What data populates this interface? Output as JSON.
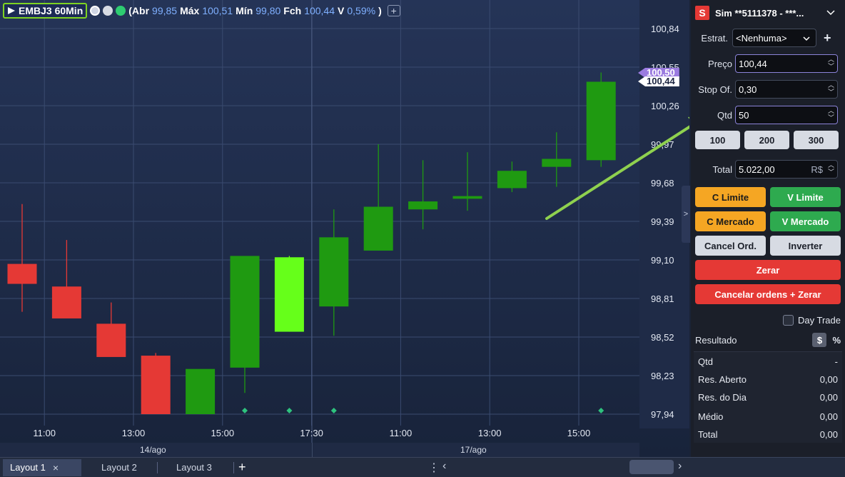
{
  "header": {
    "symbol": "EMBJ3 60Min",
    "ohlc_open_label": "(Abr",
    "ohlc_open": "99,85",
    "ohlc_high_label": "Máx",
    "ohlc_high": "100,51",
    "ohlc_low_label": "Mín",
    "ohlc_low": "99,80",
    "ohlc_close_label": "Fch",
    "ohlc_close": "100,44",
    "ohlc_var_label": "V",
    "ohlc_var": "0,59%",
    "ohlc_close_paren": ")",
    "add_study": "+"
  },
  "price_tags": {
    "last": "100,50",
    "close": "100,44"
  },
  "collapse_arrow": ">",
  "dates": [
    "14/ago",
    "17/ago"
  ],
  "colors": {
    "up": "#1f9a11",
    "up_bright": "#66ff1a",
    "down": "#e53935",
    "accent": "#7ed321"
  },
  "chart_data": {
    "type": "candlestick",
    "y_ticks": [
      "100,84",
      "100,55",
      "100,26",
      "99,97",
      "99,68",
      "99,39",
      "99,10",
      "98,81",
      "98,52",
      "98,23",
      "97,94"
    ],
    "x_ticks": [
      "11:00",
      "13:00",
      "15:00",
      "17:30",
      "11:00",
      "13:00",
      "15:00"
    ],
    "ylim": [
      97.94,
      100.84
    ],
    "candles": [
      {
        "o": 99.07,
        "h": 99.52,
        "l": 98.71,
        "c": 98.92,
        "color": "down"
      },
      {
        "o": 98.9,
        "h": 99.25,
        "l": 98.8,
        "c": 98.66,
        "color": "down"
      },
      {
        "o": 98.62,
        "h": 98.78,
        "l": 98.41,
        "c": 98.37,
        "color": "down"
      },
      {
        "o": 98.38,
        "h": 98.4,
        "l": 97.94,
        "c": 97.94,
        "color": "down"
      },
      {
        "o": 97.94,
        "h": 98.27,
        "l": 97.94,
        "c": 98.28,
        "color": "up"
      },
      {
        "o": 98.29,
        "h": 99.0,
        "l": 98.1,
        "c": 99.13,
        "color": "up"
      },
      {
        "o": 98.56,
        "h": 99.13,
        "l": 98.56,
        "c": 99.12,
        "color": "up_bright"
      },
      {
        "o": 98.75,
        "h": 99.48,
        "l": 98.53,
        "c": 99.27,
        "color": "up"
      },
      {
        "o": 99.17,
        "h": 99.97,
        "l": 99.17,
        "c": 99.5,
        "color": "up"
      },
      {
        "o": 99.48,
        "h": 99.85,
        "l": 99.33,
        "c": 99.54,
        "color": "up"
      },
      {
        "o": 99.56,
        "h": 99.91,
        "l": 99.47,
        "c": 99.58,
        "color": "up"
      },
      {
        "o": 99.64,
        "h": 99.84,
        "l": 99.61,
        "c": 99.77,
        "color": "up"
      },
      {
        "o": 99.8,
        "h": 100.06,
        "l": 99.65,
        "c": 99.86,
        "color": "up"
      },
      {
        "o": 99.85,
        "h": 100.51,
        "l": 99.8,
        "c": 100.44,
        "color": "up"
      }
    ],
    "markers_at_candles": [
      5,
      6,
      7,
      13
    ]
  },
  "panel": {
    "account_icon": "S",
    "account": "Sim **5111378 - ***...",
    "strategy_label": "Estrat.",
    "strategy_value": "<Nenhuma>",
    "price_label": "Preço",
    "price_value": "100,44",
    "stop_label": "Stop Of.",
    "stop_value": "0,30",
    "qty_label": "Qtd",
    "qty_value": "50",
    "qty_presets": [
      "100",
      "200",
      "300"
    ],
    "total_label": "Total",
    "total_value": "5.022,00",
    "total_currency": "R$",
    "buy_limit": "C Limite",
    "sell_limit": "V Limite",
    "buy_market": "C Mercado",
    "sell_market": "V Mercado",
    "cancel_orders": "Cancel Ord.",
    "invert": "Inverter",
    "flatten": "Zerar",
    "cancel_and_flatten": "Cancelar ordens + Zerar",
    "day_trade": "Day Trade",
    "result_label": "Resultado",
    "result_currency_toggle": "$",
    "result_percent_toggle": "%",
    "results": [
      {
        "label": "Qtd",
        "value": "-"
      },
      {
        "label": "Res. Aberto",
        "value": "0,00"
      },
      {
        "label": "Res. do Dia",
        "value": "0,00"
      },
      {
        "label": "Médio",
        "value": "0,00"
      },
      {
        "label": "Total",
        "value": "0,00"
      }
    ]
  },
  "tabs": [
    {
      "label": "Layout 1",
      "active": true
    },
    {
      "label": "Layout 2",
      "active": false
    },
    {
      "label": "Layout 3",
      "active": false
    }
  ],
  "tab_close": "×",
  "tab_add": "+",
  "tab_menu": "⋮",
  "tab_left": "‹",
  "tab_right": "›"
}
